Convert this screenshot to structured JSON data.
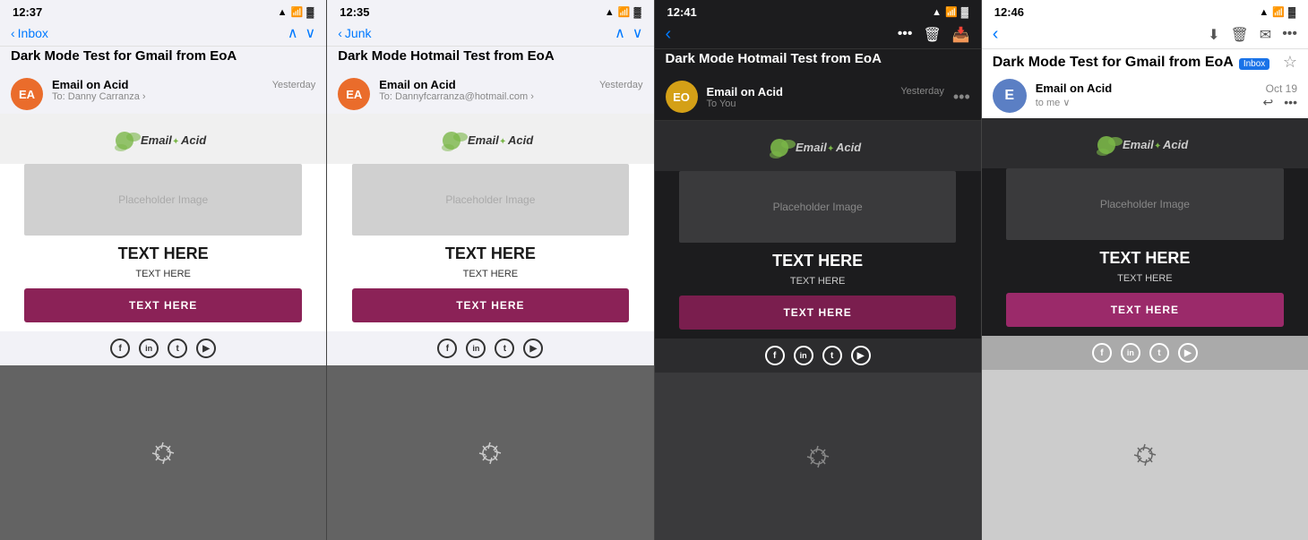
{
  "panels": [
    {
      "id": "panel1",
      "theme": "light",
      "status": {
        "time": "12:37",
        "signal": "●●●",
        "wifi": "WiFi",
        "battery": "🔋"
      },
      "nav": {
        "back_label": "Inbox",
        "has_arrows": true,
        "up_arrow": "∧",
        "down_arrow": "∨"
      },
      "sender": {
        "avatar_initials": "EA",
        "avatar_color": "#ea6c2b",
        "name": "Email on Acid",
        "to_label": "To:",
        "to_name": "Danny Carranza",
        "date": "Yesterday"
      },
      "subject": "Dark Mode Test for Gmail from EoA",
      "email": {
        "logo_text": "Email ✦ Acid",
        "placeholder_label": "Placeholder Image",
        "heading": "TEXT HERE",
        "body_text": "TEXT HERE",
        "cta_label": "TEXT HERE",
        "social_icons": [
          "f",
          "in",
          "t",
          "▶"
        ],
        "footer_splat": "✳"
      }
    },
    {
      "id": "panel2",
      "theme": "light",
      "status": {
        "time": "12:35",
        "signal": "●●●",
        "wifi": "WiFi",
        "battery": "🔋"
      },
      "nav": {
        "back_label": "Junk",
        "has_arrows": true,
        "up_arrow": "∧",
        "down_arrow": "∨"
      },
      "sender": {
        "avatar_initials": "EA",
        "avatar_color": "#ea6c2b",
        "name": "Email on Acid",
        "to_label": "To:",
        "to_name": "Dannyfcarranza@hotmail.com",
        "date": "Yesterday"
      },
      "subject": "Dark Mode Hotmail Test from EoA",
      "email": {
        "logo_text": "Email ✦ Acid",
        "placeholder_label": "Placeholder Image",
        "heading": "TEXT HERE",
        "body_text": "TEXT HERE",
        "cta_label": "TEXT HERE",
        "social_icons": [
          "f",
          "in",
          "t",
          "▶"
        ],
        "footer_splat": "✳"
      }
    },
    {
      "id": "panel3",
      "theme": "dark",
      "status": {
        "time": "12:41",
        "signal": "●●●",
        "wifi": "WiFi",
        "battery": "🔋"
      },
      "nav": {
        "back_label": "‹",
        "has_arrows": false,
        "nav_icons": [
          "•••",
          "🗑",
          "📥"
        ]
      },
      "subject": "Dark Mode Hotmail Test from EoA",
      "sender": {
        "avatar_initials": "EO",
        "avatar_color": "#d4a017",
        "name": "Email on Acid",
        "to_label": "To You",
        "date": "Yesterday"
      },
      "email": {
        "logo_text": "Email ✦ Acid",
        "placeholder_label": "Placeholder Image",
        "heading": "TEXT HERE",
        "body_text": "TEXT HERE",
        "cta_label": "TEXT HERE",
        "social_icons": [
          "f",
          "in",
          "t",
          "▶"
        ],
        "footer_splat": "✳"
      }
    },
    {
      "id": "panel4",
      "theme": "gmail-dark",
      "status": {
        "time": "12:46",
        "signal": "●●●",
        "wifi": "WiFi",
        "battery": "🔋"
      },
      "nav": {
        "back_label": "‹",
        "has_arrows": false,
        "nav_icons": [
          "📥",
          "🗑",
          "✉",
          "•••"
        ]
      },
      "subject": "Dark Mode Test for Gmail from EoA",
      "inbox_badge": "Inbox",
      "sender": {
        "avatar_color": "#5b7fc4",
        "avatar_letter": "E",
        "name": "Email on Acid",
        "date": "Oct 19",
        "to_me": "to me ∨"
      },
      "email": {
        "logo_text": "Email ✦ Acid",
        "placeholder_label": "Placeholder Image",
        "heading": "TEXT HERE",
        "body_text": "TEXT HERE",
        "cta_label": "TEXT HERE",
        "social_icons": [
          "f",
          "in",
          "t",
          "▶"
        ],
        "footer_splat": "✳"
      }
    }
  ],
  "colors": {
    "cta_light": "#8b2257",
    "cta_dark": "#7a1e4e",
    "cta_gmail": "#9b2a6a",
    "social_light_border": "#333",
    "social_dark_border": "#fff",
    "logo_green": "#7ab648",
    "back_blue": "#007aff"
  }
}
